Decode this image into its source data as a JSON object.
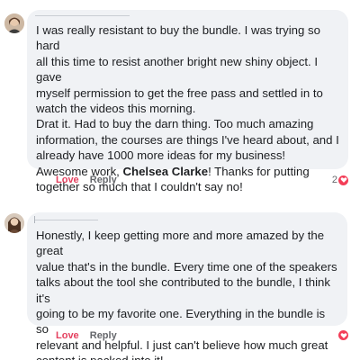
{
  "comments": [
    {
      "text_before": "I was really resistant to buy the bundle. I was trying so hard\nall this time to resist another bright new shiny object. I gave\nmyself permission to get the free pass and settled in to\nwatch the videos this morning.\nDrat it. Had to buy the darn thing. Too much amazing\ninformation, the courses are things I've heard about, and I\nalready have 1000 more ideas for my business!\nAwesome work, ",
      "mention": "Chelsea Clarke",
      "text_after": "! Thanks for putting\ntogether so much that I couldn't say no!",
      "love_label": "Love",
      "reply_label": "Reply",
      "reaction_count": "2"
    },
    {
      "text": "Honestly, I keep getting more and more amazed by the great\nvalue that's in the bundle. Every time one of the speakers\ntalks about the tool she contributed to the bundle, I think it's\ngoing to be my favorite one. Everything in the bundle is so\nrelevant and helpful. I just can't believe how much great\ncontent is packed into it!",
      "love_label": "Love",
      "reply_label": "Reply",
      "reaction_count": ""
    }
  ],
  "colors": {
    "bubble": "#f0f2f5",
    "love": "#e4405f",
    "heart": "#f33e58",
    "text": "#1c1e21",
    "muted": "#65676b"
  }
}
